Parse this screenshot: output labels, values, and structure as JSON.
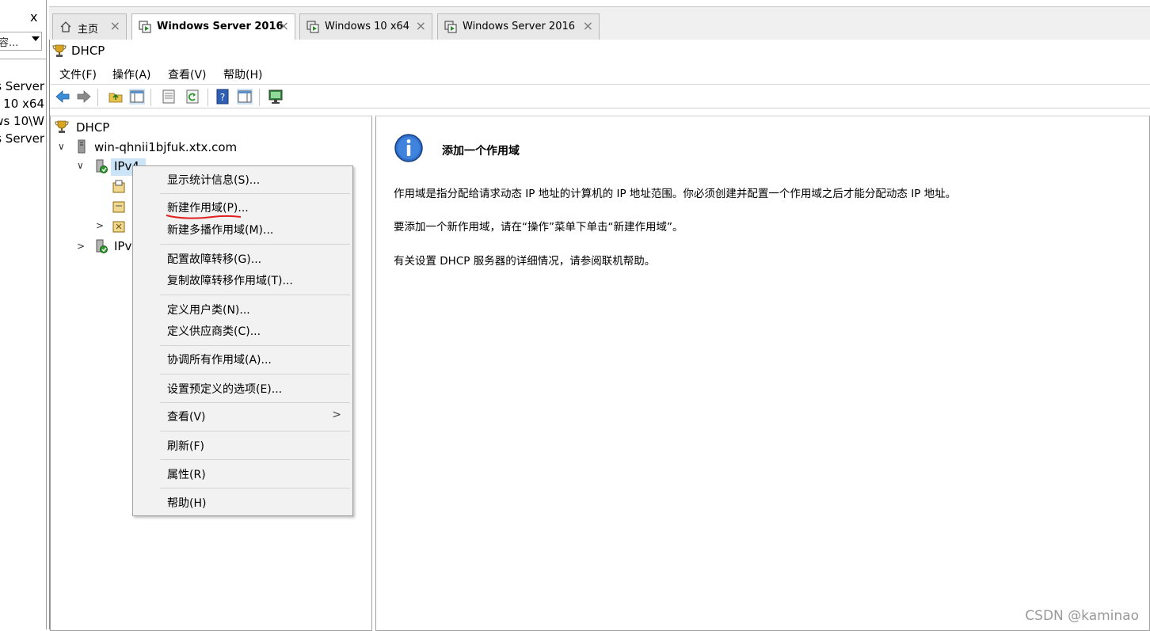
{
  "library": {
    "close_glyph": "x",
    "search_text": "容...",
    "items": [
      "s Server",
      "s 10 x64",
      "ws 10\\W",
      "s Server"
    ]
  },
  "tabs": [
    {
      "label": "主页",
      "icon": "home-icon",
      "active": false
    },
    {
      "label": "Windows Server 2016",
      "icon": "vm-icon",
      "active": true
    },
    {
      "label": "Windows 10 x64",
      "icon": "vm-icon",
      "active": false
    },
    {
      "label": "Windows Server 2016",
      "icon": "vm-icon",
      "active": false
    }
  ],
  "window": {
    "title": "DHCP",
    "icon": "dhcp-trophy-icon"
  },
  "menubar": [
    "文件(F)",
    "操作(A)",
    "查看(V)",
    "帮助(H)"
  ],
  "toolbar": [
    "back-icon",
    "forward-icon",
    "up-folder-icon",
    "show-hide-tree-icon",
    "properties-icon",
    "refresh-icon",
    "help-icon",
    "show-hide-action-pane-icon",
    "monitor-icon"
  ],
  "tree": {
    "root": "DHCP",
    "server": "win-qhnii1bjfuk.xtx.com",
    "ipv4": "IPv4",
    "ipv6": "IPv6"
  },
  "context_menu": {
    "items": [
      "显示统计信息(S)...",
      "新建作用域(P)...",
      "新建多播作用域(M)...",
      "配置故障转移(G)...",
      "复制故障转移作用域(T)...",
      "定义用户类(N)...",
      "定义供应商类(C)...",
      "协调所有作用域(A)...",
      "设置预定义的选项(E)...",
      "查看(V)",
      "刷新(F)",
      "属性(R)",
      "帮助(H)"
    ],
    "highlighted": "新建作用域(P)..."
  },
  "details": {
    "heading": "添加一个作用域",
    "paragraphs": [
      "作用域是指分配给请求动态 IP 地址的计算机的 IP 地址范围。你必须创建并配置一个作用域之后才能分配动态 IP 地址。",
      "要添加一个新作用域，请在“操作”菜单下单击“新建作用域”。",
      "有关设置 DHCP 服务器的详细情况，请参阅联机帮助。"
    ]
  },
  "watermark": "CSDN @kaminao",
  "colors": {
    "accent_blue": "#2f6fc9",
    "annotation_red": "#e02020"
  }
}
